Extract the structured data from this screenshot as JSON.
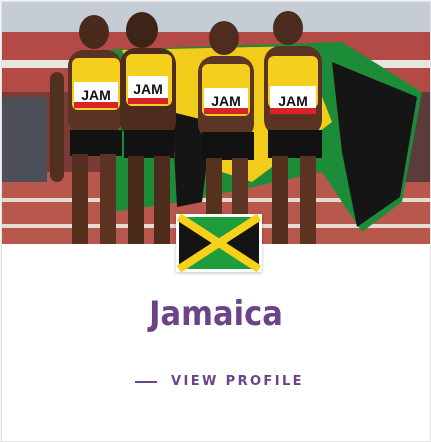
{
  "card": {
    "photo": {
      "alt": "Jamaican sprinters holding the Jamaican flag",
      "bibs": [
        "JAM",
        "JAM",
        "JAM",
        "JAM"
      ]
    },
    "flag": {
      "icon": "jamaica-flag-icon",
      "colors": {
        "green": "#1f9c3c",
        "gold": "#f7d11a",
        "black": "#141414"
      }
    },
    "country_name": "Jamaica",
    "view_profile_label": "VIEW PROFILE",
    "accent_color": "#6b4487"
  }
}
